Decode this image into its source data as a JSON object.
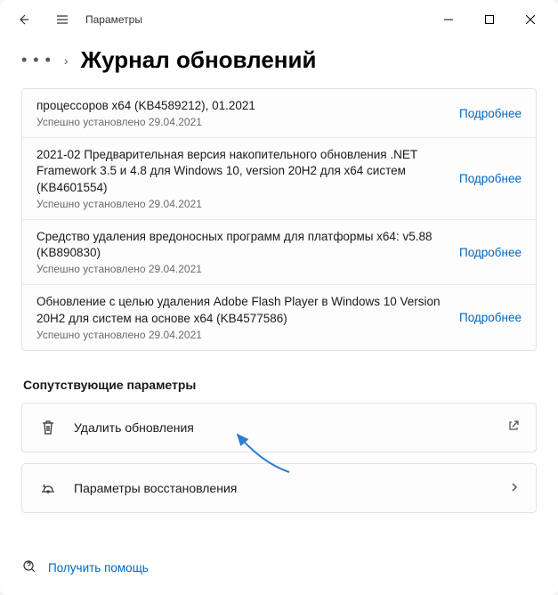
{
  "titlebar": {
    "title": "Параметры"
  },
  "breadcrumb": {
    "page_title": "Журнал обновлений"
  },
  "updates": [
    {
      "title": "процессоров x64 (KB4589212), 01.2021",
      "status": "Успешно установлено 29.04.2021",
      "more": "Подробнее"
    },
    {
      "title": "2021-02 Предварительная версия накопительного обновления .NET Framework 3.5 и 4.8 для Windows 10, version 20H2 для x64 систем (KB4601554)",
      "status": "Успешно установлено 29.04.2021",
      "more": "Подробнее"
    },
    {
      "title": "Средство удаления вредоносных программ для платформы x64: v5.88 (KB890830)",
      "status": "Успешно установлено 29.04.2021",
      "more": "Подробнее"
    },
    {
      "title": "Обновление с целью удаления Adobe Flash Player в Windows 10 Version 20H2 для систем на основе x64 (KB4577586)",
      "status": "Успешно установлено 29.04.2021",
      "more": "Подробнее"
    }
  ],
  "related": {
    "header": "Сопутствующие параметры",
    "uninstall": "Удалить обновления",
    "recovery": "Параметры восстановления"
  },
  "footer": {
    "help": "Получить помощь"
  }
}
